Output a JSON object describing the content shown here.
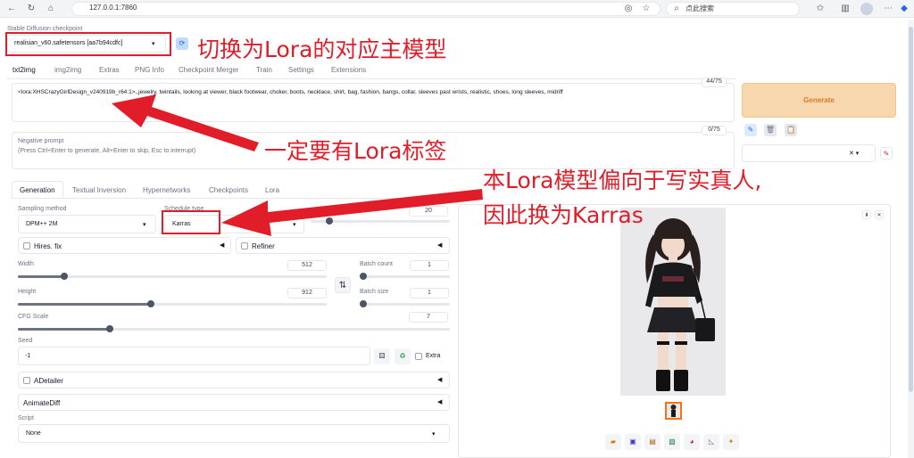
{
  "browser": {
    "url": "127.0.0.1:7860",
    "search_placeholder": "点此搜索"
  },
  "checkpoint": {
    "label": "Stable Diffusion checkpoint",
    "value": "realisian_v60.safetensors [aa7b94cdfc]"
  },
  "main_tabs": [
    "txt2img",
    "img2img",
    "Extras",
    "PNG Info",
    "Checkpoint Merger",
    "Train",
    "Settings",
    "Extensions"
  ],
  "prompt": {
    "value": "<lora:XHSCrazyGirlDesign_v240919b_r64:1>,,jewelry, twintails, looking at viewer, black footwear, choker, boots, necklace, shirt, bag, fashion, bangs, collar, sleeves past wrists, realistic, shoes, long sleeves, midriff",
    "counter": "44/75"
  },
  "negative": {
    "label": "Negative prompt",
    "hint": "(Press Ctrl+Enter to generate, Alt+Enter to skip, Esc to interrupt)",
    "counter": "0/75"
  },
  "generate_label": "Generate",
  "sub_tabs": [
    "Generation",
    "Textual Inversion",
    "Hypernetworks",
    "Checkpoints",
    "Lora"
  ],
  "sampling": {
    "label": "Sampling method",
    "value": "DPM++ 2M",
    "schedule_label": "Schedule type",
    "schedule_value": "Karras",
    "steps": "20"
  },
  "hires_label": "Hires. fix",
  "refiner_label": "Refiner",
  "width": {
    "label": "Width",
    "value": "512",
    "fraction": 0.15
  },
  "height": {
    "label": "Height",
    "value": "912",
    "fraction": 0.43
  },
  "batch_count": {
    "label": "Batch count",
    "value": "1"
  },
  "batch_size": {
    "label": "Batch size",
    "value": "1"
  },
  "swap_icon": "⇅",
  "cfg": {
    "label": "CFG Scale",
    "value": "7"
  },
  "seed": {
    "label": "Seed",
    "value": "-1",
    "extra_label": "Extra"
  },
  "adetailer_label": "ADetailer",
  "animatediff_label": "AnimateDiff",
  "script": {
    "label": "Script",
    "value": "None"
  },
  "annotations": {
    "a1": "切换为Lora的对应主模型",
    "a2": "一定要有Lora标签",
    "a3_line1": "本Lora模型偏向于写实真人,",
    "a3_line2": "因此换为Karras"
  },
  "colors": {
    "accent_red": "#e11d2a",
    "generate_bg": "#f7d7ad",
    "generate_text": "#d9782f"
  }
}
